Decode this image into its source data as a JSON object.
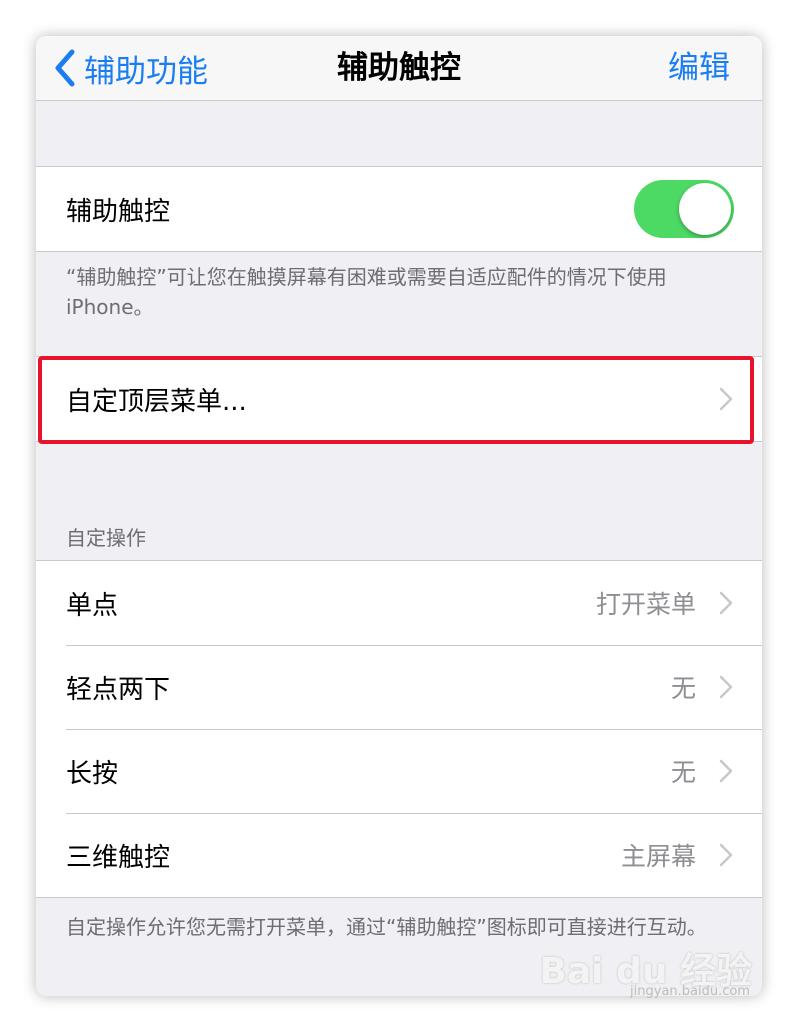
{
  "nav": {
    "back_label": "辅助功能",
    "title": "辅助触控",
    "edit_label": "编辑"
  },
  "assistive_touch": {
    "label": "辅助触控",
    "enabled": true,
    "footnote": "“辅助触控”可让您在触摸屏幕有困难或需要自适应配件的情况下使用 iPhone。"
  },
  "top_level_menu": {
    "label": "自定顶层菜单..."
  },
  "custom_actions": {
    "header": "自定操作",
    "items": [
      {
        "label": "单点",
        "value": "打开菜单"
      },
      {
        "label": "轻点两下",
        "value": "无"
      },
      {
        "label": "长按",
        "value": "无"
      },
      {
        "label": "三维触控",
        "value": "主屏幕"
      }
    ],
    "footnote": "自定操作允许您无需打开菜单，通过“辅助触控”图标即可直接进行互动。"
  },
  "watermark": {
    "logo": "Bai du 经验",
    "url": "jingyan.baidu.com"
  },
  "colors": {
    "accent": "#1a7ef2",
    "toggle_on": "#4cd964",
    "highlight": "#e8122a"
  }
}
